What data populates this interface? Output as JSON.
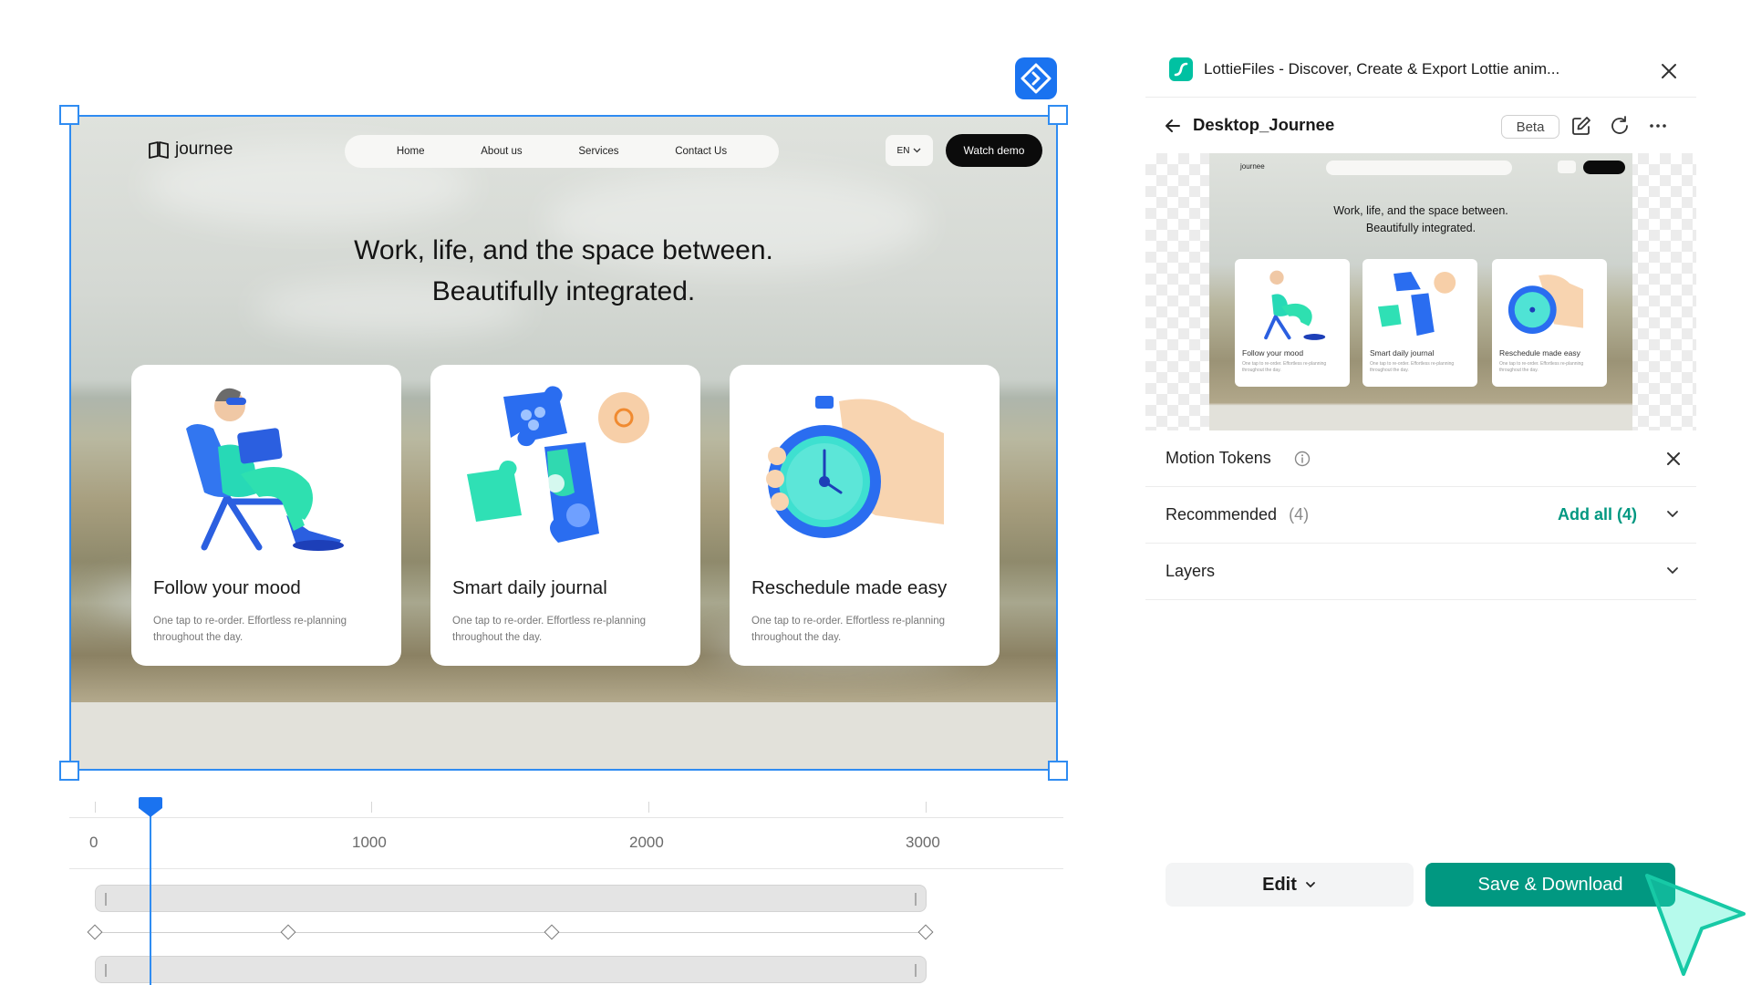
{
  "canvas": {
    "site": {
      "logo_text": "journee",
      "nav": [
        "Home",
        "About us",
        "Services",
        "Contact Us"
      ],
      "lang": "EN",
      "watch_demo": "Watch demo",
      "hero_line1": "Work, life, and the space between.",
      "hero_line2": "Beautifully integrated.",
      "cards": [
        {
          "title": "Follow your mood",
          "desc": "One tap to re-order. Effortless re-planning throughout the day."
        },
        {
          "title": "Smart daily journal",
          "desc": "One tap to re-order. Effortless re-planning throughout the day."
        },
        {
          "title": "Reschedule made easy",
          "desc": "One tap to re-order. Effortless re-planning throughout the day."
        }
      ]
    },
    "selection_color": "#2f8cf2"
  },
  "timeline": {
    "ticks": [
      "0",
      "1000",
      "2000",
      "3000"
    ],
    "playhead_ms": 200,
    "keyframes_ms": [
      0,
      700,
      1650,
      3000
    ]
  },
  "panel": {
    "title": "LottieFiles - Discover, Create & Export Lottie anim...",
    "file_name": "Desktop_Journee",
    "beta_label": "Beta",
    "motion_tokens_label": "Motion Tokens",
    "recommended_label": "Recommended",
    "recommended_count": "(4)",
    "add_all_label": "Add all (4)",
    "layers_label": "Layers",
    "edit_label": "Edit",
    "save_label": "Save & Download",
    "accent": "#019881",
    "icons": {
      "close": "close-icon",
      "back": "arrow-left-icon",
      "edit": "pencil-square-icon",
      "refresh": "refresh-icon",
      "more": "more-horizontal-icon",
      "info": "info-icon",
      "chevron": "chevron-down-icon"
    }
  }
}
